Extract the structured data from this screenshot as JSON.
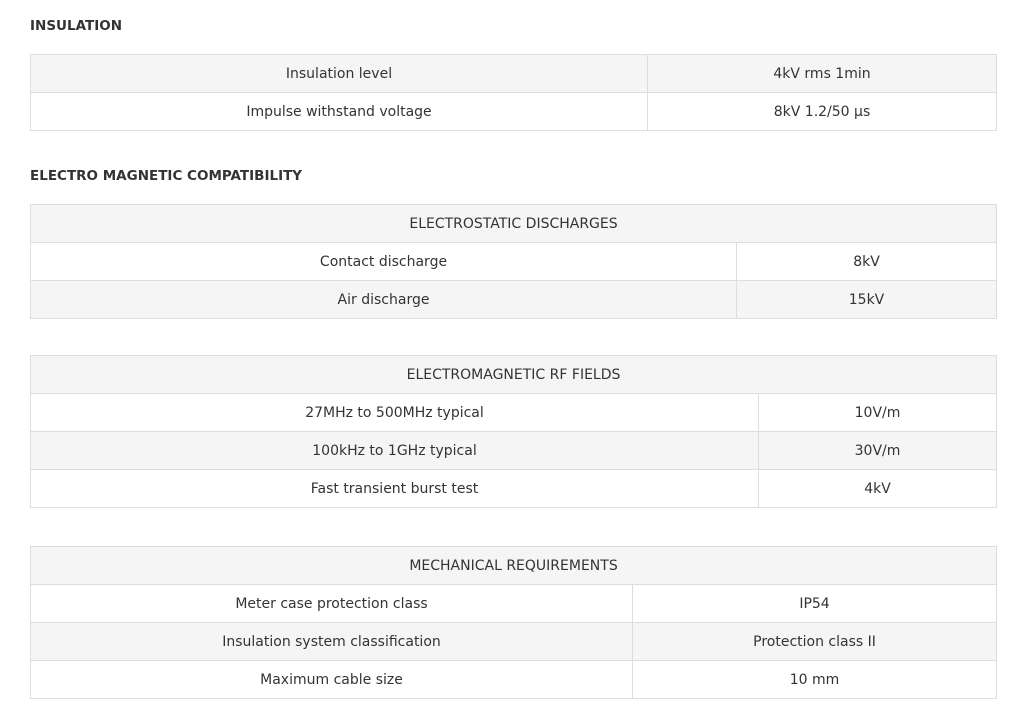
{
  "insulation": {
    "heading": "INSULATION",
    "rows": [
      {
        "label": "Insulation level",
        "value": "4kV rms 1min"
      },
      {
        "label": "Impulse withstand voltage",
        "value": "8kV 1.2/50 µs"
      }
    ]
  },
  "emc": {
    "heading": "ELECTRO MAGNETIC COMPATIBILITY"
  },
  "electrostatic": {
    "title": "ELECTROSTATIC DISCHARGES",
    "rows": [
      {
        "label": "Contact discharge",
        "value": "8kV"
      },
      {
        "label": "Air discharge",
        "value": "15kV"
      }
    ]
  },
  "rf_fields": {
    "title": "ELECTROMAGNETIC RF FIELDS",
    "rows": [
      {
        "label": "27MHz to 500MHz typical",
        "value": "10V/m"
      },
      {
        "label": "100kHz to 1GHz typical",
        "value": "30V/m"
      },
      {
        "label": "Fast transient burst test",
        "value": "4kV"
      }
    ]
  },
  "mechanical": {
    "title": "MECHANICAL REQUIREMENTS",
    "rows": [
      {
        "label": "Meter case protection class",
        "value": "IP54"
      },
      {
        "label": "Insulation system classification",
        "value": "Protection class II"
      },
      {
        "label": "Maximum cable size",
        "value": "10 mm"
      }
    ]
  }
}
